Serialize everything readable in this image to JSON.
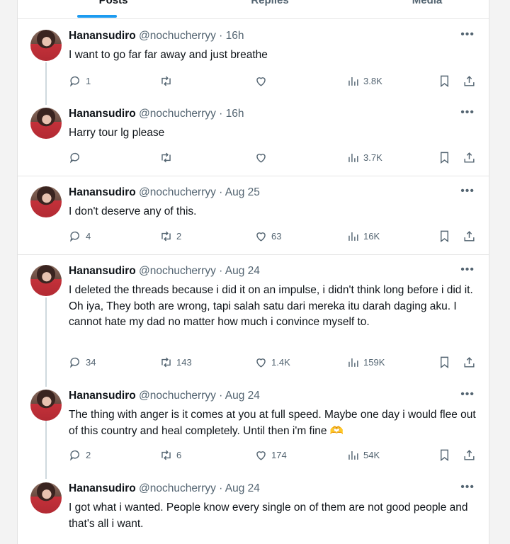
{
  "tabs": [
    "Posts",
    "Replies",
    "Media"
  ],
  "tweets": [
    {
      "name": "Hanansudiro",
      "handle": "@nochucherryy",
      "time": "16h",
      "text": "I want to go far far away and just breathe",
      "replies": "1",
      "retweets": "",
      "likes": "",
      "views": "3.8K"
    },
    {
      "name": "Hanansudiro",
      "handle": "@nochucherryy",
      "time": "16h",
      "text": "Harry tour lg please",
      "replies": "",
      "retweets": "",
      "likes": "",
      "views": "3.7K"
    },
    {
      "name": "Hanansudiro",
      "handle": "@nochucherryy",
      "time": "Aug 25",
      "text": "I don't deserve any of this.",
      "replies": "4",
      "retweets": "2",
      "likes": "63",
      "views": "16K"
    },
    {
      "name": "Hanansudiro",
      "handle": "@nochucherryy",
      "time": "Aug 24",
      "text": "I deleted the threads because i did it on an impulse, i didn't think long before i did it. Oh iya, They both are wrong, tapi salah satu dari mereka itu darah daging aku. I cannot hate my dad no matter how much i convince myself to.",
      "replies": "34",
      "retweets": "143",
      "likes": "1.4K",
      "views": "159K"
    },
    {
      "name": "Hanansudiro",
      "handle": "@nochucherryy",
      "time": "Aug 24",
      "text": "The thing with anger is it comes at you at full speed. Maybe one day i would flee out of this country and heal completely. Until then i'm fine 🫶",
      "replies": "2",
      "retweets": "6",
      "likes": "174",
      "views": "54K"
    },
    {
      "name": "Hanansudiro",
      "handle": "@nochucherryy",
      "time": "Aug 24",
      "text": "I got what i wanted. People know every single on of them are not good people and that's all i want.",
      "replies": "",
      "retweets": "",
      "likes": "",
      "views": ""
    }
  ],
  "icons": {
    "reply": "reply-icon",
    "retweet": "retweet-icon",
    "like": "heart-icon",
    "views": "views-icon",
    "bookmark": "bookmark-icon",
    "share": "share-icon",
    "more": "more-icon"
  },
  "colors": {
    "accent": "#1d9bf0",
    "muted": "#536471"
  }
}
